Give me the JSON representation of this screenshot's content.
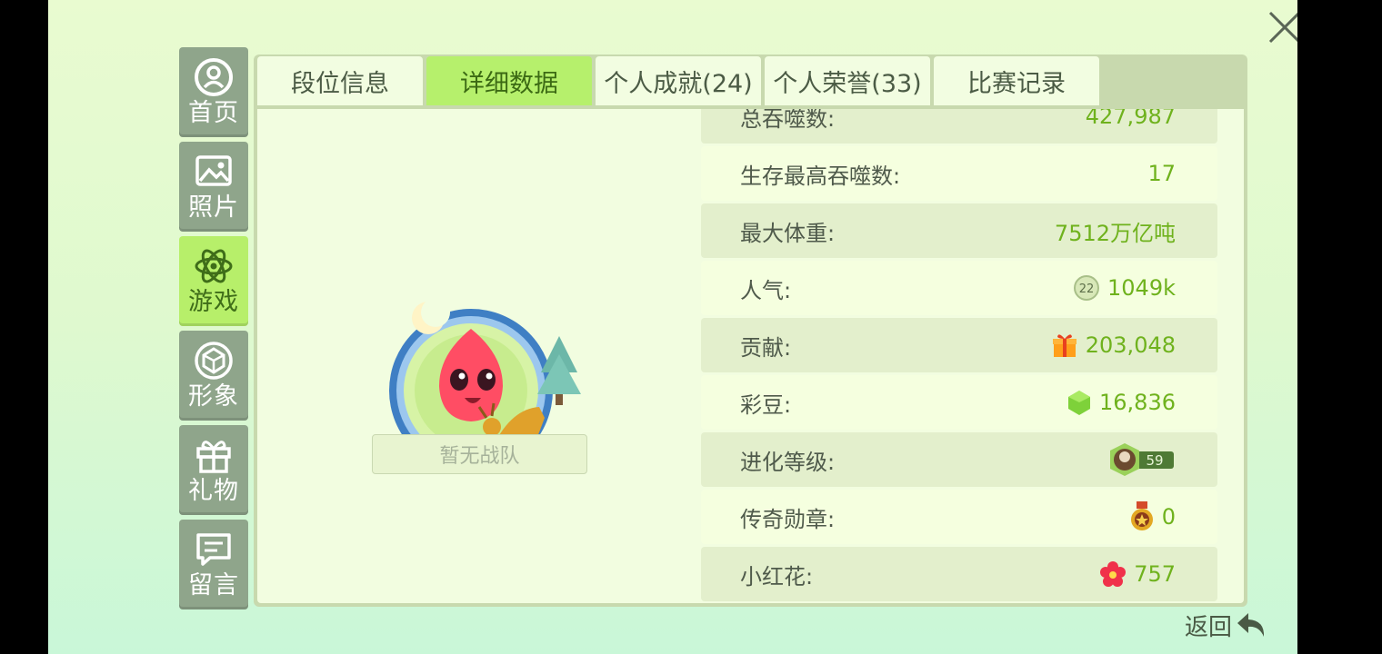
{
  "close_label": "×",
  "sidebar": {
    "items": [
      {
        "label": "首页",
        "icon": "profile-icon",
        "active": false
      },
      {
        "label": "照片",
        "icon": "photo-icon",
        "active": false
      },
      {
        "label": "游戏",
        "icon": "atom-icon",
        "active": true
      },
      {
        "label": "形象",
        "icon": "diamond-icon",
        "active": false
      },
      {
        "label": "礼物",
        "icon": "gift-icon",
        "active": false
      },
      {
        "label": "留言",
        "icon": "message-icon",
        "active": false
      }
    ]
  },
  "tabs": [
    {
      "label": "段位信息",
      "active": false
    },
    {
      "label": "详细数据",
      "active": true
    },
    {
      "label": "个人成就(24)",
      "active": false
    },
    {
      "label": "个人荣誉(33)",
      "active": false
    },
    {
      "label": "比赛记录",
      "active": false
    }
  ],
  "profile": {
    "team_label": "暂无战队"
  },
  "stats": [
    {
      "label": "总吞噬数:",
      "value": "427,987",
      "icon": null
    },
    {
      "label": "生存最高吞噬数:",
      "value": "17",
      "icon": null
    },
    {
      "label": "最大体重:",
      "value": "7512万亿吨",
      "icon": null
    },
    {
      "label": "人气:",
      "value": "1049k",
      "icon": "popularity-badge-icon",
      "icon_text": "22"
    },
    {
      "label": "贡献:",
      "value": "203,048",
      "icon": "gift-box-icon"
    },
    {
      "label": "彩豆:",
      "value": "16,836",
      "icon": "green-gem-icon"
    },
    {
      "label": "进化等级:",
      "value": "",
      "icon": "evolution-badge-icon",
      "icon_text": "59"
    },
    {
      "label": "传奇勋章:",
      "value": "0",
      "icon": "legend-medal-icon"
    },
    {
      "label": "小红花:",
      "value": "757",
      "icon": "red-flower-icon"
    }
  ],
  "back_label": "返回",
  "colors": {
    "accent_green": "#b6f06c",
    "value_green": "#6fb21d",
    "nav_gray": "#8fa58b"
  }
}
